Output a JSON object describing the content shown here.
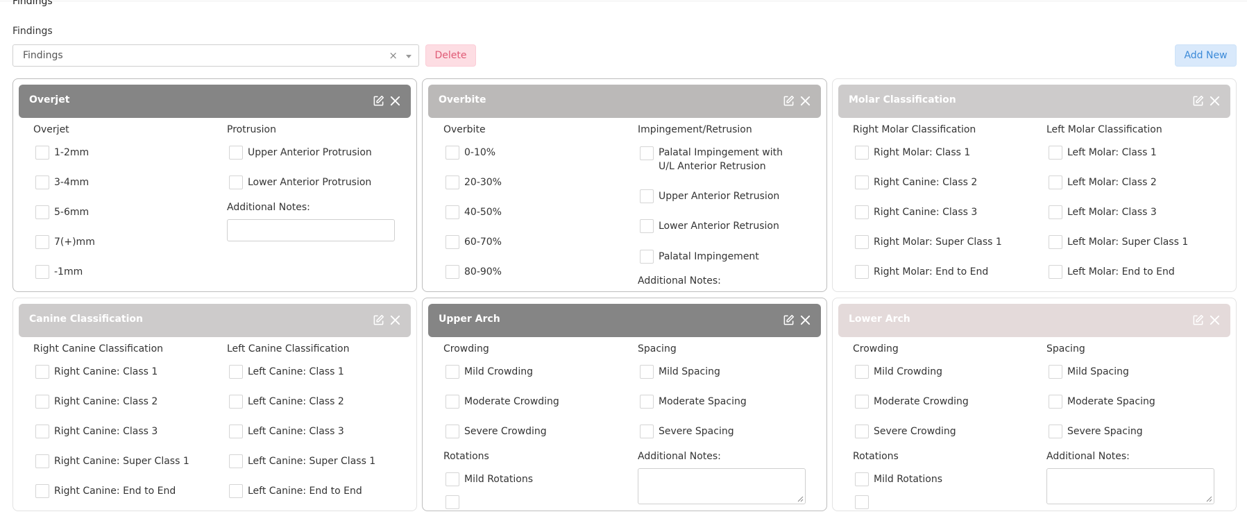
{
  "page": {
    "title": "Findings",
    "field_label": "Findings",
    "select_value": "Findings",
    "clear_glyph": "×",
    "delete_label": "Delete",
    "add_label": "Add New"
  },
  "colors": {
    "header_dark": "#858585",
    "header_mid": "#bbb9b8",
    "header_light": "#cdcbcb",
    "header_pink": "#e4dada"
  },
  "cards": {
    "overjet": {
      "title": "Overjet",
      "col1": {
        "title": "Overjet",
        "options": [
          "1-2mm",
          "3-4mm",
          "5-6mm",
          "7(+)mm",
          "-1mm"
        ]
      },
      "col2": {
        "title": "Protrusion",
        "options": [
          "Upper Anterior Protrusion",
          "Lower Anterior Protrusion"
        ],
        "notes_label": "Additional Notes:"
      }
    },
    "overbite": {
      "title": "Overbite",
      "col1": {
        "title": "Overbite",
        "options": [
          "0-10%",
          "20-30%",
          "40-50%",
          "60-70%",
          "80-90%"
        ]
      },
      "col2": {
        "title": "Impingement/Retrusion",
        "options": [
          "Palatal Impingement with U/L Anterior Retrusion",
          "Upper Anterior Retrusion",
          "Lower Anterior Retrusion",
          "Palatal Impingement"
        ],
        "notes_label": "Additional Notes:"
      }
    },
    "molar": {
      "title": "Molar Classification",
      "col1": {
        "title": "Right Molar Classification",
        "options": [
          "Right Molar: Class 1",
          "Right Canine: Class 2",
          "Right Canine: Class 3",
          "Right Molar: Super Class 1",
          "Right Molar: End to End"
        ]
      },
      "col2": {
        "title": "Left Molar Classification",
        "options": [
          "Left Molar: Class 1",
          "Left Molar: Class 2",
          "Left Molar: Class 3",
          "Left Molar: Super Class 1",
          "Left Molar: End to End"
        ]
      }
    },
    "canine": {
      "title": "Canine Classification",
      "col1": {
        "title": "Right Canine Classification",
        "options": [
          "Right Canine: Class 1",
          "Right Canine: Class 2",
          "Right Canine: Class 3",
          "Right Canine: Super Class 1",
          "Right Canine: End to End"
        ]
      },
      "col2": {
        "title": "Left Canine Classification",
        "options": [
          "Left Canine: Class 1",
          "Left Canine: Class 2",
          "Left Canine: Class 3",
          "Left Canine: Super Class 1",
          "Left Canine: End to End"
        ]
      }
    },
    "upper_arch": {
      "title": "Upper Arch",
      "col1": {
        "title": "Crowding",
        "options": [
          "Mild Crowding",
          "Moderate Crowding",
          "Severe Crowding"
        ],
        "sub_title": "Rotations",
        "sub_options": [
          "Mild Rotations"
        ]
      },
      "col2": {
        "title": "Spacing",
        "options": [
          "Mild Spacing",
          "Moderate Spacing",
          "Severe Spacing"
        ],
        "notes_label": "Additional Notes:"
      }
    },
    "lower_arch": {
      "title": "Lower Arch",
      "col1": {
        "title": "Crowding",
        "options": [
          "Mild Crowding",
          "Moderate Crowding",
          "Severe Crowding"
        ],
        "sub_title": "Rotations",
        "sub_options": [
          "Mild Rotations"
        ]
      },
      "col2": {
        "title": "Spacing",
        "options": [
          "Mild Spacing",
          "Moderate Spacing",
          "Severe Spacing"
        ],
        "notes_label": "Additional Notes:"
      }
    }
  }
}
